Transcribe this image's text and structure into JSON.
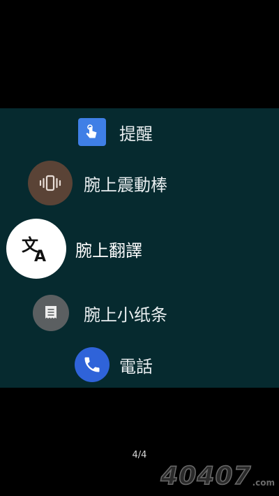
{
  "apps": [
    {
      "label": "提醒",
      "icon": "reminder-touch-icon",
      "icon_bg": "#3f7fe6"
    },
    {
      "label": "腕上震動棒",
      "icon": "vibrate-icon",
      "icon_bg": "#5a4336"
    },
    {
      "label": "腕上翻譯",
      "icon": "translate-icon",
      "icon_bg": "#ffffff"
    },
    {
      "label": "腕上小纸条",
      "icon": "notes-icon",
      "icon_bg": "#5b5f61"
    },
    {
      "label": "電話",
      "icon": "phone-icon",
      "icon_bg": "#2f63d9"
    }
  ],
  "pager": {
    "text": "4/4"
  },
  "watermark": {
    "number": "40407",
    "suffix": ".com"
  },
  "colors": {
    "screen_bg": "#062a2f",
    "page_bg": "#000000"
  }
}
